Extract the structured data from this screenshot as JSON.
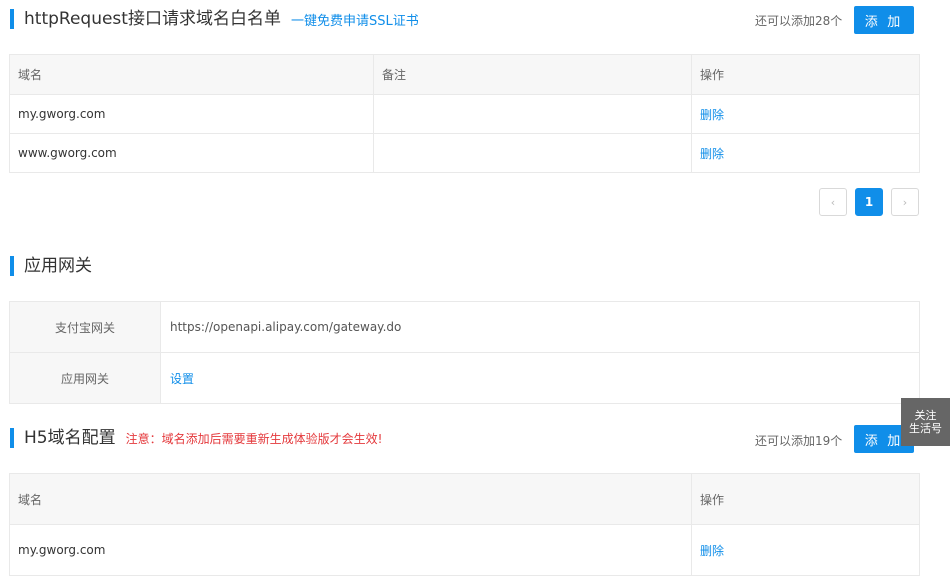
{
  "http_section": {
    "title": "httpRequest接口请求域名白名单",
    "ssl_link": "一键免费申请SSL证书",
    "quota": "还可以添加28个",
    "add_label": "添 加",
    "columns": [
      "域名",
      "备注",
      "操作"
    ],
    "rows": [
      {
        "domain": "my.gworg.com",
        "remark": "",
        "action": "删除"
      },
      {
        "domain": "www.gworg.com",
        "remark": "",
        "action": "删除"
      }
    ],
    "pagination": {
      "prev": "‹",
      "current": "1",
      "next": "›"
    }
  },
  "gateway_section": {
    "title": "应用网关",
    "rows": [
      {
        "label": "支付宝网关",
        "value": "https://openapi.alipay.com/gateway.do"
      },
      {
        "label": "应用网关",
        "value": "设置"
      }
    ]
  },
  "h5_section": {
    "title": "H5域名配置",
    "warning": "注意：域名添加后需要重新生成体验版才会生效!",
    "quota": "还可以添加19个",
    "add_label": "添 加",
    "columns": [
      "域名",
      "操作"
    ],
    "rows": [
      {
        "domain": "my.gworg.com",
        "action": "删除"
      }
    ]
  },
  "float_button": {
    "line1": "关注",
    "line2": "生活号"
  },
  "colors": {
    "accent": "#108ee9",
    "warning": "#e4393c",
    "header_bg": "#f7f7f7"
  }
}
